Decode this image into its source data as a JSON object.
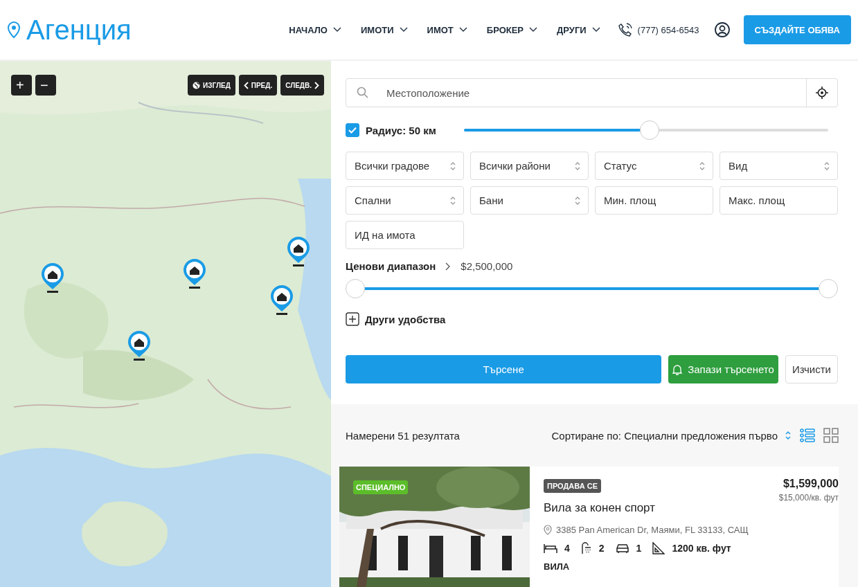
{
  "header": {
    "logo": "Агенция",
    "nav": [
      {
        "label": "НАЧАЛО"
      },
      {
        "label": "ИМОТИ"
      },
      {
        "label": "ИМОТ"
      },
      {
        "label": "БРОКЕР"
      },
      {
        "label": "ДРУГИ"
      }
    ],
    "phone": "(777) 654-6543",
    "cta": "СЪЗДАЙТЕ ОБЯВА"
  },
  "map": {
    "kind": "picture",
    "zoom_in": "+",
    "zoom_out": "−",
    "view": "ИЗГЛЕД",
    "prev": "ПРЕД.",
    "next": "СЛЕДВ."
  },
  "search": {
    "location": {
      "placeholder": "Местоположение"
    },
    "radius": {
      "checked": true,
      "label": "Радиус: 50 км",
      "level": 0.51
    },
    "filters": [
      {
        "kind": "select",
        "label": "Всички градове"
      },
      {
        "kind": "select",
        "label": "Всички райони"
      },
      {
        "kind": "select",
        "label": "Статус"
      },
      {
        "kind": "select",
        "label": "Вид"
      },
      {
        "kind": "select",
        "label": "Спални"
      },
      {
        "kind": "select",
        "label": "Бани"
      },
      {
        "kind": "input",
        "placeholder": "Мин. площ"
      },
      {
        "kind": "input",
        "placeholder": "Макс. площ"
      },
      {
        "kind": "input",
        "placeholder": "ИД на имота"
      }
    ],
    "price_range": {
      "label": "Ценови диапазон",
      "value": "$2,500,000",
      "handles": [
        {
          "level": 0
        },
        {
          "level": 1
        }
      ]
    },
    "amenities": {
      "label": "Други удобства",
      "expanded": false
    },
    "buttons": {
      "search": "Търсене",
      "save": "Запази търсенето",
      "clear": "Изчисти"
    }
  },
  "results": {
    "count": "Намерени 51 резултата",
    "sort": "Сортиране по: Специални предложения първо",
    "views": [
      {
        "kind": "list",
        "selected": true
      },
      {
        "kind": "grid",
        "selected": false
      }
    ],
    "listings": [
      {
        "badge": "СПЕЦИАЛНО",
        "status": "ПРОДАВА СЕ",
        "title": "Вила за конен спорт",
        "address": "3385 Pan American Dr, Маями, FL 33133, САЩ",
        "price": "$1,599,000",
        "price_per_area": "$15,000/кв. фут",
        "beds": "4",
        "baths": "2",
        "garage": "1",
        "area": "1200 кв. фут",
        "type": "ВИЛА"
      }
    ]
  }
}
